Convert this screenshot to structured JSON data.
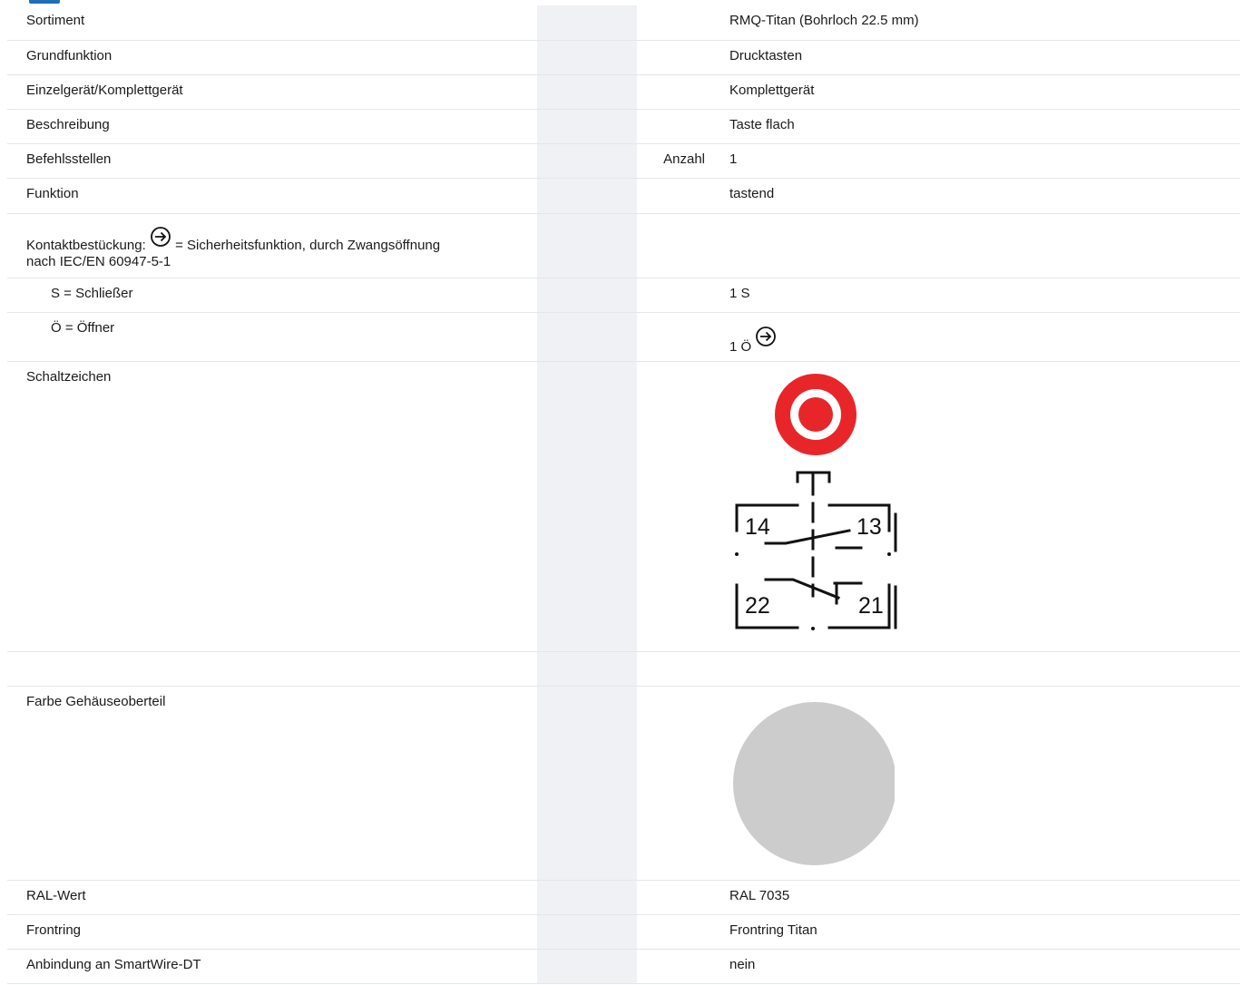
{
  "rows": [
    {
      "label": "Sortiment",
      "value": "RMQ-Titan (Bohrloch 22.5 mm)"
    },
    {
      "label": "Grundfunktion",
      "value": "Drucktasten"
    },
    {
      "label": "Einzelgerät/Komplettgerät",
      "value": "Komplettgerät"
    },
    {
      "label": "Beschreibung",
      "value": "Taste flach"
    },
    {
      "label": "Befehlsstellen",
      "unit": "Anzahl",
      "value": "1"
    },
    {
      "label": "Funktion",
      "value": "tastend"
    }
  ],
  "contact": {
    "label_prefix": "Kontaktbestückung:",
    "label_suffix": "= Sicherheitsfunktion, durch Zwangsöffnung",
    "label_line2": "nach IEC/EN 60947-5-1",
    "symbol_icon": "positive-opening-icon",
    "no_label": "S = Schließer",
    "no_value": "1 S",
    "nc_label": "Ö = Öffner",
    "nc_value": "1 Ö"
  },
  "schaltzeichen": {
    "label": "Schaltzeichen",
    "terminals": [
      "14",
      "13",
      "22",
      "21"
    ],
    "button_color": "#e8262a"
  },
  "housing": {
    "label": "Farbe Gehäuseoberteil",
    "swatch_color": "#cccccc"
  },
  "rows2": [
    {
      "label": "RAL-Wert",
      "value": "RAL 7035"
    },
    {
      "label": "Frontring",
      "value": "Frontring Titan"
    },
    {
      "label": "Anbindung an SmartWire-DT",
      "value": "nein"
    }
  ],
  "colors": {
    "stripe": "#eff1f5",
    "divider": "#e3e6ea",
    "accent": "#1f6fb8"
  }
}
